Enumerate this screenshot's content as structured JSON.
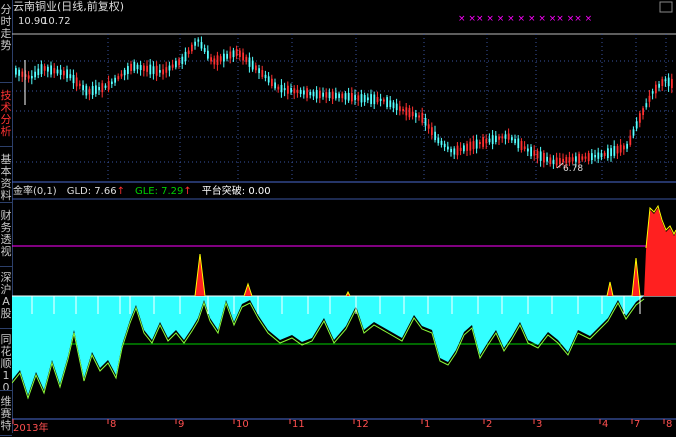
{
  "sidebar": {
    "tabs": [
      {
        "label": "分时走势",
        "active": false
      },
      {
        "label": "技术分析",
        "active": true
      },
      {
        "label": "基本资料",
        "active": false
      },
      {
        "label": "财务透视",
        "active": false
      },
      {
        "label": "深沪A股",
        "active": false
      },
      {
        "label": "同花顺10",
        "active": false
      },
      {
        "label": "维赛特",
        "active": false
      }
    ]
  },
  "chart": {
    "title": "云南铜业(日线,前复权)",
    "price_overlay_a": "10.90",
    "price_overlay_b": "10.72",
    "low_marker": "6.78",
    "event_markers": "× ×× × × ×    ×    ×   × ××  ××   ×",
    "colors": {
      "up": "#ff3030",
      "down": "#54ffff",
      "grid": "#3a55a0",
      "magenta": "#ff00ff",
      "green": "#00d000",
      "yellow": "#ffff00"
    }
  },
  "indicator": {
    "name": "金率(0,1)",
    "gld_label": "GLD: 7.66",
    "gle_label": "GLE: 7.29",
    "breakout_label": "平台突破: 0.00",
    "gld_arrow": "↑",
    "gle_arrow": "↑"
  },
  "x_axis": {
    "labels": [
      "2013年",
      "8",
      "9",
      "10",
      "11",
      "12",
      "1",
      "2",
      "3",
      "4",
      "7",
      "8"
    ]
  }
}
